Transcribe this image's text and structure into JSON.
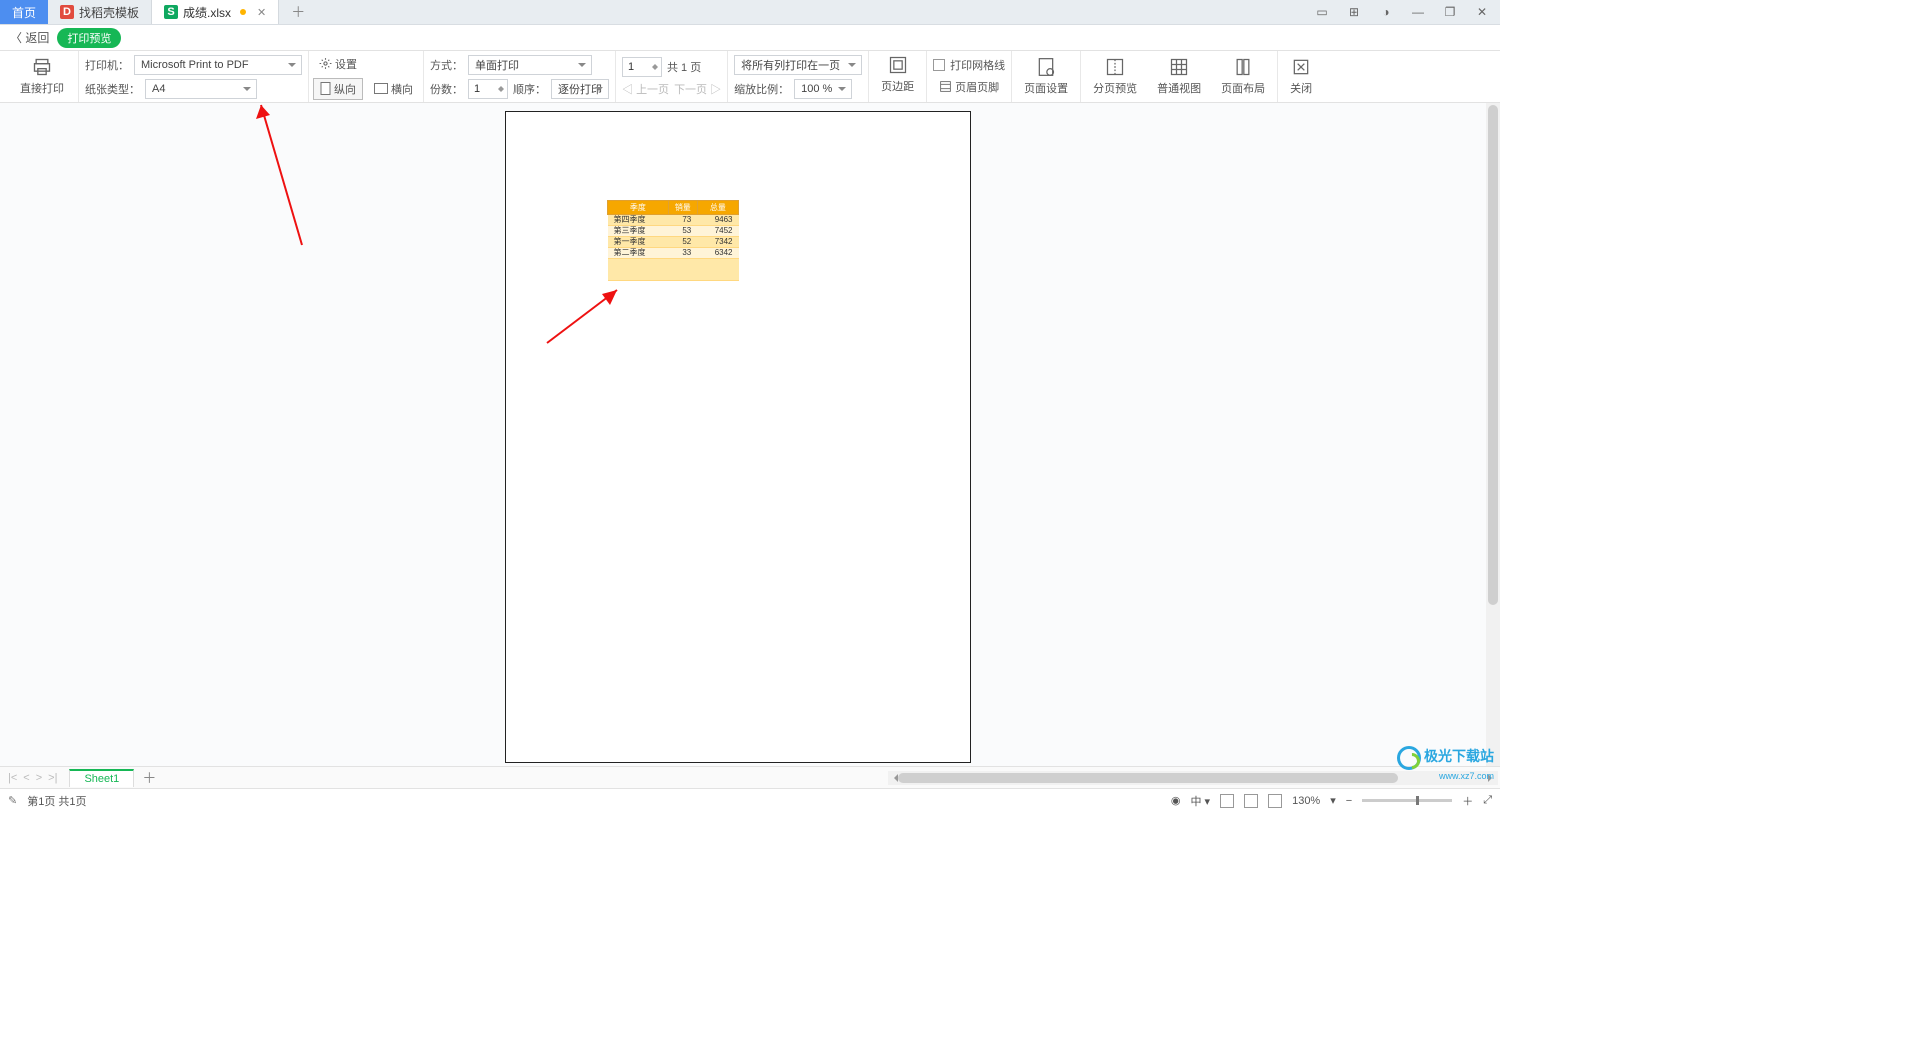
{
  "tabs": {
    "home": "首页",
    "template": "找稻壳模板",
    "file": "成绩.xlsx"
  },
  "backbar": {
    "back": "返回",
    "pill": "打印预览"
  },
  "toolbar": {
    "direct_print": "直接打印",
    "printer_lbl": "打印机：",
    "printer_val": "Microsoft Print to PDF",
    "paper_lbl": "纸张类型：",
    "paper_val": "A4",
    "settings": "设置",
    "portrait": "纵向",
    "landscape": "横向",
    "mode_lbl": "方式：",
    "mode_val": "单面打印",
    "copies_lbl": "份数：",
    "copies_val": "1",
    "order_lbl": "顺序：",
    "order_val": "逐份打印",
    "page_spin": "1",
    "page_total": "共 1 页",
    "prev": "上一页",
    "next": "下一页",
    "fit_val": "将所有列打印在一页",
    "zoom_lbl": "缩放比例：",
    "zoom_val": "100 %",
    "margins": "页边距",
    "gridlines": "打印网格线",
    "header_footer": "页眉页脚",
    "page_setup": "页面设置",
    "page_break": "分页预览",
    "normal_view": "普通视图",
    "page_layout": "页面布局",
    "close": "关闭"
  },
  "table": {
    "headers": [
      "季度",
      "销量",
      "总量"
    ],
    "rows": [
      [
        "第四季度",
        "73",
        "9463"
      ],
      [
        "第三季度",
        "53",
        "7452"
      ],
      [
        "第一季度",
        "52",
        "7342"
      ],
      [
        "第二季度",
        "33",
        "6342"
      ]
    ]
  },
  "sheet": {
    "name": "Sheet1"
  },
  "status": {
    "page": "第1页 共1页",
    "zoom": "130%",
    "ime": "中"
  },
  "statusbar_icons": {
    "eye": "◉"
  },
  "watermark": {
    "t1": "极光下载站",
    "t2": "www.xz7.com"
  }
}
